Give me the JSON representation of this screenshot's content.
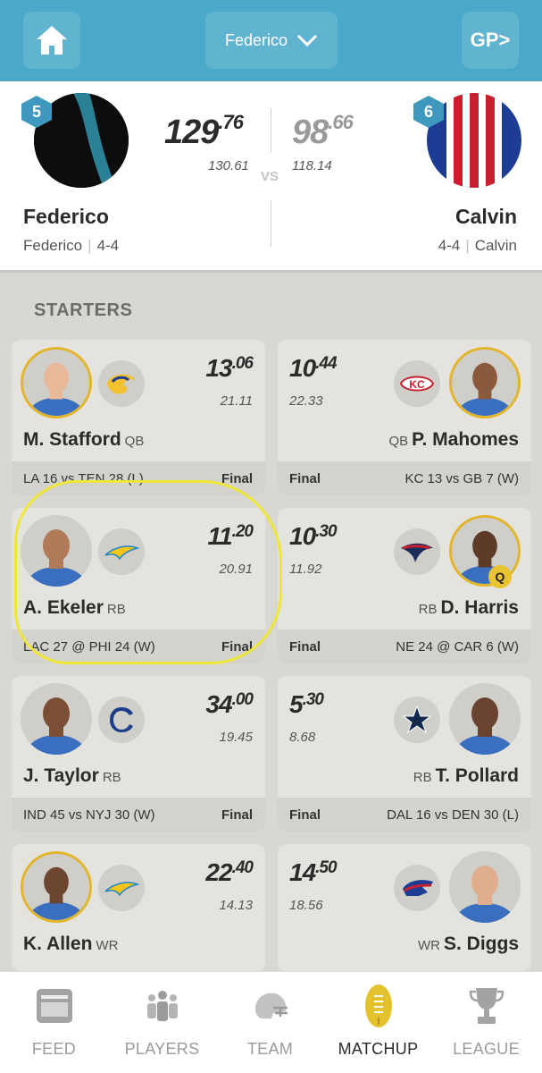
{
  "topbar": {
    "team_switch_label": "Federico",
    "gp_label": "GP>"
  },
  "matchup": {
    "home": {
      "rank": "5",
      "score_int": "129",
      "score_dec": ".76",
      "projected": "130.61",
      "name": "Federico",
      "owner": "Federico",
      "record": "4-4"
    },
    "vs_label": "VS",
    "away": {
      "rank": "6",
      "score_int": "98",
      "score_dec": ".66",
      "projected": "118.14",
      "name": "Calvin",
      "owner": "Calvin",
      "record": "4-4"
    }
  },
  "section_label": "STARTERS",
  "rows": [
    {
      "left": {
        "name": "M. Stafford",
        "pos": "QB",
        "pts_int": "13",
        "pts_dec": ".06",
        "proj": "21.11",
        "game": "LA 16 vs TEN 28 (L)",
        "status": "Final",
        "team_icon": "rams-logo-icon",
        "gold": true
      },
      "right": {
        "name": "P. Mahomes",
        "pos": "QB",
        "pts_int": "10",
        "pts_dec": ".44",
        "proj": "22.33",
        "game": "KC 13 vs GB 7 (W)",
        "status": "Final",
        "team_icon": "chiefs-logo-icon",
        "gold": true
      }
    },
    {
      "left": {
        "name": "A. Ekeler",
        "pos": "RB",
        "pts_int": "11",
        "pts_dec": ".20",
        "proj": "20.91",
        "game": "LAC 27 @ PHI 24 (W)",
        "status": "Final",
        "team_icon": "chargers-logo-icon",
        "gold": false
      },
      "right": {
        "name": "D. Harris",
        "pos": "RB",
        "pts_int": "10",
        "pts_dec": ".30",
        "proj": "11.92",
        "game": "NE 24 @ CAR 6 (W)",
        "status": "Final",
        "team_icon": "patriots-logo-icon",
        "gold": true,
        "badge": "Q"
      }
    },
    {
      "left": {
        "name": "J. Taylor",
        "pos": "RB",
        "pts_int": "34",
        "pts_dec": ".00",
        "proj": "19.45",
        "game": "IND 45 vs NYJ 30 (W)",
        "status": "Final",
        "team_icon": "colts-logo-icon",
        "gold": false
      },
      "right": {
        "name": "T. Pollard",
        "pos": "RB",
        "pts_int": "5",
        "pts_dec": ".30",
        "proj": "8.68",
        "game": "DAL 16 vs DEN 30 (L)",
        "status": "Final",
        "team_icon": "cowboys-logo-icon",
        "gold": false
      }
    },
    {
      "left": {
        "name": "K. Allen",
        "pos": "WR",
        "pts_int": "22",
        "pts_dec": ".40",
        "proj": "14.13",
        "team_icon": "chargers-logo-icon",
        "gold": true
      },
      "right": {
        "name": "S. Diggs",
        "pos": "WR",
        "pts_int": "14",
        "pts_dec": ".50",
        "proj": "18.56",
        "team_icon": "bills-logo-icon",
        "gold": false
      }
    }
  ],
  "nav": [
    {
      "label": "FEED",
      "icon": "feed-icon"
    },
    {
      "label": "PLAYERS",
      "icon": "players-icon"
    },
    {
      "label": "TEAM",
      "icon": "helmet-icon"
    },
    {
      "label": "MATCHUP",
      "icon": "football-icon",
      "active": true
    },
    {
      "label": "LEAGUE",
      "icon": "trophy-icon"
    }
  ],
  "colors": {
    "topbar": "#4aa9c9",
    "rank_badge": "#3f98be",
    "gold_ring": "#e3b52a",
    "highlight": "#eee73a"
  }
}
